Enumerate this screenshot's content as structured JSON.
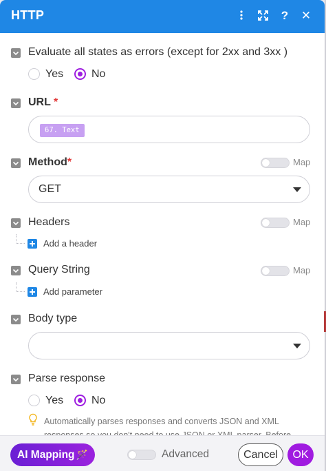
{
  "header": {
    "title": "HTTP",
    "icons": [
      "kebab-menu-icon",
      "expand-icon",
      "help-icon",
      "close-icon"
    ],
    "help_glyph": "?",
    "close_glyph": "✕",
    "color": "#1f87e5"
  },
  "evaluate": {
    "label": "Evaluate all states as errors (except for 2xx and 3xx )",
    "yes_label": "Yes",
    "no_label": "No",
    "selected": "No"
  },
  "url": {
    "label": "URL",
    "required_mark": "*",
    "value_token": "67. Text"
  },
  "method": {
    "label": "Method",
    "required_mark": "*",
    "map_label": "Map",
    "value": "GET"
  },
  "headers": {
    "label": "Headers",
    "map_label": "Map",
    "add_label": "Add a header"
  },
  "query_string": {
    "label": "Query String",
    "map_label": "Map",
    "add_label": "Add parameter"
  },
  "body_type": {
    "label": "Body type",
    "value": ""
  },
  "parse_response": {
    "label": "Parse response",
    "yes_label": "Yes",
    "no_label": "No",
    "selected": "No",
    "note": "Automatically parses responses and converts JSON and XML responses so you don't need to use JSON or XML parser. Before"
  },
  "footer": {
    "ai_mapping_label": "AI Mapping",
    "ai_icon": "magic-wand-icon",
    "wand_glyph": "🪄",
    "advanced_label": "Advanced",
    "cancel_label": "Cancel",
    "ok_label": "OK"
  },
  "colors": {
    "accent": "#9e1ee0",
    "header": "#1f87e5",
    "token": "#c7a0f2"
  }
}
